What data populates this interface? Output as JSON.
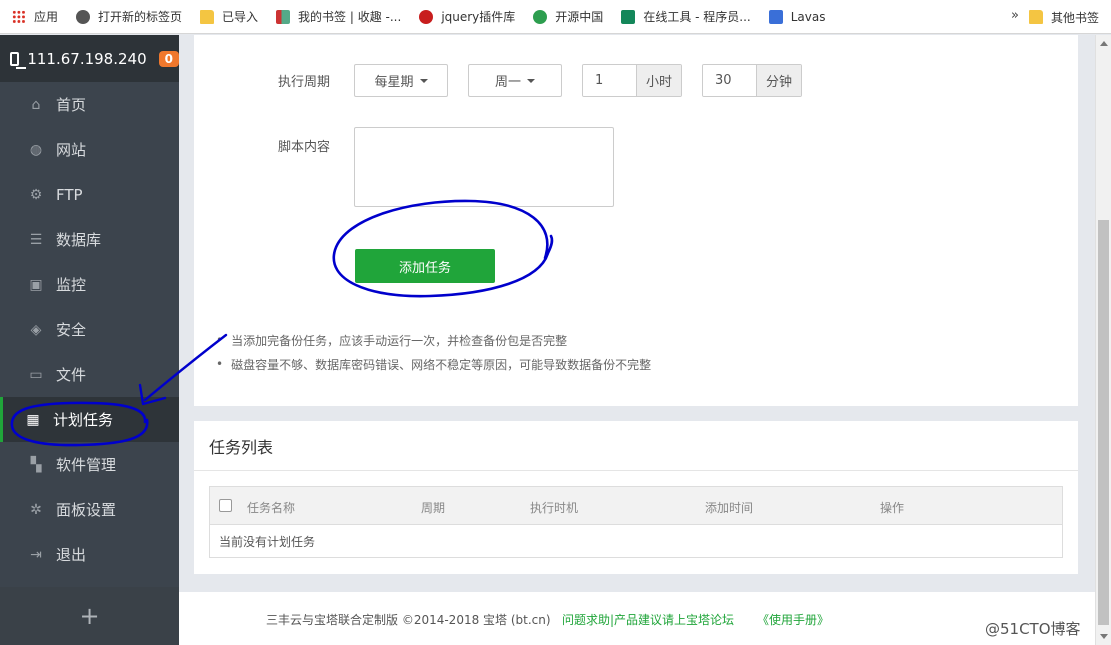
{
  "bookmarks": {
    "items": [
      {
        "label": "应用",
        "icon": "apps-grid-icon"
      },
      {
        "label": "打开新的标签页",
        "icon": "globe-icon"
      },
      {
        "label": "已导入",
        "icon": "folder-icon"
      },
      {
        "label": "我的书签 | 收趣 -...",
        "icon": "bookmark-icon"
      },
      {
        "label": "jquery插件库",
        "icon": "jquery-icon"
      },
      {
        "label": "开源中国",
        "icon": "oschina-icon"
      },
      {
        "label": "在线工具 - 程序员...",
        "icon": "tool-icon"
      },
      {
        "label": "Lavas",
        "icon": "lavas-icon"
      }
    ],
    "more": "»",
    "other": "其他书签"
  },
  "sidebar": {
    "ip": "111.67.198.240",
    "badge": "0",
    "items": [
      {
        "label": "首页",
        "icon": "home-icon"
      },
      {
        "label": "网站",
        "icon": "globe-icon"
      },
      {
        "label": "FTP",
        "icon": "ftp-icon"
      },
      {
        "label": "数据库",
        "icon": "database-icon"
      },
      {
        "label": "监控",
        "icon": "monitor-icon"
      },
      {
        "label": "安全",
        "icon": "shield-icon"
      },
      {
        "label": "文件",
        "icon": "folder-icon"
      },
      {
        "label": "计划任务",
        "icon": "calendar-icon"
      },
      {
        "label": "软件管理",
        "icon": "apps-icon"
      },
      {
        "label": "面板设置",
        "icon": "gear-icon"
      },
      {
        "label": "退出",
        "icon": "logout-icon"
      }
    ],
    "active": "计划任务",
    "plus": "+"
  },
  "form": {
    "period_label": "执行周期",
    "period_select": "每星期",
    "weekday_select": "周一",
    "hour_value": "1",
    "hour_unit": "小时",
    "minute_value": "30",
    "minute_unit": "分钟",
    "script_label": "脚本内容",
    "script_value": "",
    "add_button": "添加任务"
  },
  "tips": [
    "当添加完备份任务，应该手动运行一次，并检查备份包是否完整",
    "磁盘容量不够、数据库密码错误、网络不稳定等原因，可能导致数据备份不完整"
  ],
  "task_list": {
    "title": "任务列表",
    "columns": [
      "任务名称",
      "周期",
      "执行时机",
      "添加时间",
      "操作"
    ],
    "empty": "当前没有计划任务"
  },
  "footer": {
    "copyright": "三丰云与宝塔联合定制版 ©2014-2018 宝塔 (bt.cn)",
    "help_link": "问题求助|产品建议请上宝塔论坛",
    "manual_link": "《使用手册》"
  },
  "watermark": "@51CTO博客",
  "colors": {
    "accent": "#20a53a",
    "sidebar": "#3c444d",
    "badge": "#f0782d",
    "annotation": "#0000cc"
  }
}
